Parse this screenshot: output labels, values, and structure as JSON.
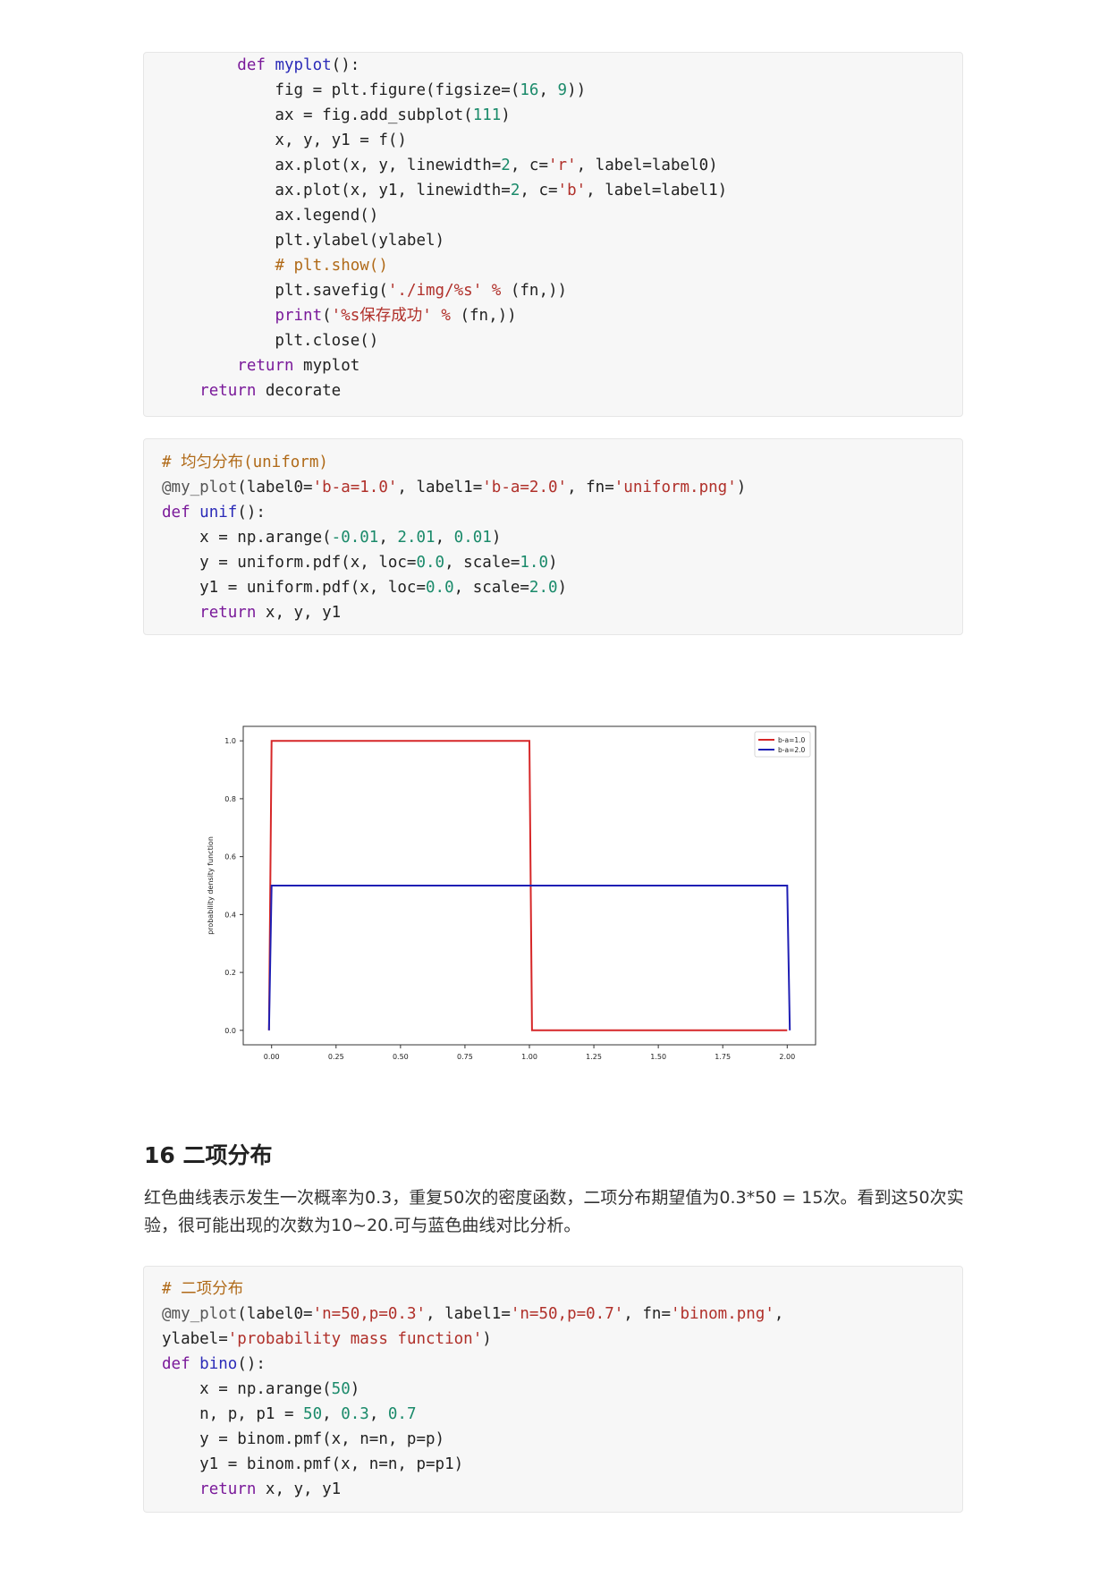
{
  "code_top": {
    "lines": [
      [
        {
          "t": "        "
        },
        {
          "t": "def",
          "c": "kw"
        },
        {
          "t": " "
        },
        {
          "t": "myplot",
          "c": "fn"
        },
        {
          "t": "():"
        }
      ],
      [
        {
          "t": "            fig = plt.figure(figsize=("
        },
        {
          "t": "16",
          "c": "num"
        },
        {
          "t": ", "
        },
        {
          "t": "9",
          "c": "num"
        },
        {
          "t": "))"
        }
      ],
      [
        {
          "t": "            ax = fig.add_subplot("
        },
        {
          "t": "111",
          "c": "num"
        },
        {
          "t": ")"
        }
      ],
      [
        {
          "t": "            x, y, y1 = f()"
        }
      ],
      [
        {
          "t": "            ax.plot(x, y, linewidth="
        },
        {
          "t": "2",
          "c": "num"
        },
        {
          "t": ", c="
        },
        {
          "t": "'r'",
          "c": "str"
        },
        {
          "t": ", label=label0)"
        }
      ],
      [
        {
          "t": "            ax.plot(x, y1, linewidth="
        },
        {
          "t": "2",
          "c": "num"
        },
        {
          "t": ", c="
        },
        {
          "t": "'b'",
          "c": "str"
        },
        {
          "t": ", label=label1)"
        }
      ],
      [
        {
          "t": "            ax.legend()"
        }
      ],
      [
        {
          "t": "            plt.ylabel(ylabel)"
        }
      ],
      [
        {
          "t": "            "
        },
        {
          "t": "# plt.show()",
          "c": "cm"
        }
      ],
      [
        {
          "t": "            plt.savefig("
        },
        {
          "t": "'./img/%s'",
          "c": "str"
        },
        {
          "t": " "
        },
        {
          "t": "%",
          "c": "str"
        },
        {
          "t": " (fn,))"
        }
      ],
      [
        {
          "t": "            "
        },
        {
          "t": "print",
          "c": "kw"
        },
        {
          "t": "("
        },
        {
          "t": "'%s保存成功'",
          "c": "str"
        },
        {
          "t": " "
        },
        {
          "t": "%",
          "c": "str"
        },
        {
          "t": " (fn,))"
        }
      ],
      [
        {
          "t": "            plt.close()"
        }
      ],
      [
        {
          "t": "        "
        },
        {
          "t": "return",
          "c": "kw"
        },
        {
          "t": " myplot"
        }
      ],
      [
        {
          "t": "    "
        },
        {
          "t": "return",
          "c": "kw"
        },
        {
          "t": " decorate"
        }
      ]
    ]
  },
  "code_uniform": {
    "lines": [
      [
        {
          "t": "# 均匀分布(uniform)",
          "c": "cm"
        }
      ],
      [
        {
          "t": "@my_plot",
          "c": "deco"
        },
        {
          "t": "(label0="
        },
        {
          "t": "'b-a=1.0'",
          "c": "str"
        },
        {
          "t": ", label1="
        },
        {
          "t": "'b-a=2.0'",
          "c": "str"
        },
        {
          "t": ", fn="
        },
        {
          "t": "'uniform.png'",
          "c": "str"
        },
        {
          "t": ")"
        }
      ],
      [
        {
          "t": "def",
          "c": "kw"
        },
        {
          "t": " "
        },
        {
          "t": "unif",
          "c": "fn"
        },
        {
          "t": "():"
        }
      ],
      [
        {
          "t": "    x = np.arange("
        },
        {
          "t": "-0.01",
          "c": "num"
        },
        {
          "t": ", "
        },
        {
          "t": "2.01",
          "c": "num"
        },
        {
          "t": ", "
        },
        {
          "t": "0.01",
          "c": "num"
        },
        {
          "t": ")"
        }
      ],
      [
        {
          "t": "    y = uniform.pdf(x, loc="
        },
        {
          "t": "0.0",
          "c": "num"
        },
        {
          "t": ", scale="
        },
        {
          "t": "1.0",
          "c": "num"
        },
        {
          "t": ")"
        }
      ],
      [
        {
          "t": "    y1 = uniform.pdf(x, loc="
        },
        {
          "t": "0.0",
          "c": "num"
        },
        {
          "t": ", scale="
        },
        {
          "t": "2.0",
          "c": "num"
        },
        {
          "t": ")"
        }
      ],
      [
        {
          "t": "    "
        },
        {
          "t": "return",
          "c": "kw"
        },
        {
          "t": " x, y, y1"
        }
      ]
    ]
  },
  "chart_data": {
    "type": "line",
    "ylabel": "probability density function",
    "xlim": [
      -0.11,
      2.11
    ],
    "ylim": [
      -0.05,
      1.05
    ],
    "xticks": [
      "0.00",
      "0.25",
      "0.50",
      "0.75",
      "1.00",
      "1.25",
      "1.50",
      "1.75",
      "2.00"
    ],
    "xtick_values": [
      0,
      0.25,
      0.5,
      0.75,
      1.0,
      1.25,
      1.5,
      1.75,
      2.0
    ],
    "yticks": [
      "0.0",
      "0.2",
      "0.4",
      "0.6",
      "0.8",
      "1.0"
    ],
    "ytick_values": [
      0,
      0.2,
      0.4,
      0.6,
      0.8,
      1.0
    ],
    "legend_position": "top-right",
    "series": [
      {
        "name": "b-a=1.0",
        "color": "#d62728",
        "x": [
          -0.01,
          0.0,
          1.0,
          1.01,
          2.0
        ],
        "y": [
          0,
          1.0,
          1.0,
          0,
          0
        ]
      },
      {
        "name": "b-a=2.0",
        "color": "#1f1fb4",
        "x": [
          -0.01,
          0.0,
          2.0,
          2.01
        ],
        "y": [
          0,
          0.5,
          0.5,
          0
        ]
      }
    ]
  },
  "heading": "16 二项分布",
  "paragraph": "红色曲线表示发生一次概率为0.3，重复50次的密度函数，二项分布期望值为0.3*50 = 15次。看到这50次实验，很可能出现的次数为10~20.可与蓝色曲线对比分析。",
  "code_binom": {
    "lines": [
      [
        {
          "t": "# 二项分布",
          "c": "cm"
        }
      ],
      [
        {
          "t": "@my_plot",
          "c": "deco"
        },
        {
          "t": "(label0="
        },
        {
          "t": "'n=50,p=0.3'",
          "c": "str"
        },
        {
          "t": ", label1="
        },
        {
          "t": "'n=50,p=0.7'",
          "c": "str"
        },
        {
          "t": ", fn="
        },
        {
          "t": "'binom.png'",
          "c": "str"
        },
        {
          "t": ","
        }
      ],
      [
        {
          "t": "ylabel="
        },
        {
          "t": "'probability mass function'",
          "c": "str"
        },
        {
          "t": ")"
        }
      ],
      [
        {
          "t": "def",
          "c": "kw"
        },
        {
          "t": " "
        },
        {
          "t": "bino",
          "c": "fn"
        },
        {
          "t": "():"
        }
      ],
      [
        {
          "t": "    x = np.arange("
        },
        {
          "t": "50",
          "c": "num"
        },
        {
          "t": ")"
        }
      ],
      [
        {
          "t": "    n, p, p1 = "
        },
        {
          "t": "50",
          "c": "num"
        },
        {
          "t": ", "
        },
        {
          "t": "0.3",
          "c": "num"
        },
        {
          "t": ", "
        },
        {
          "t": "0.7",
          "c": "num"
        }
      ],
      [
        {
          "t": "    y = binom.pmf(x, n=n, p=p)"
        }
      ],
      [
        {
          "t": "    y1 = binom.pmf(x, n=n, p=p1)"
        }
      ],
      [
        {
          "t": "    "
        },
        {
          "t": "return",
          "c": "kw"
        },
        {
          "t": " x, y, y1"
        }
      ]
    ]
  }
}
